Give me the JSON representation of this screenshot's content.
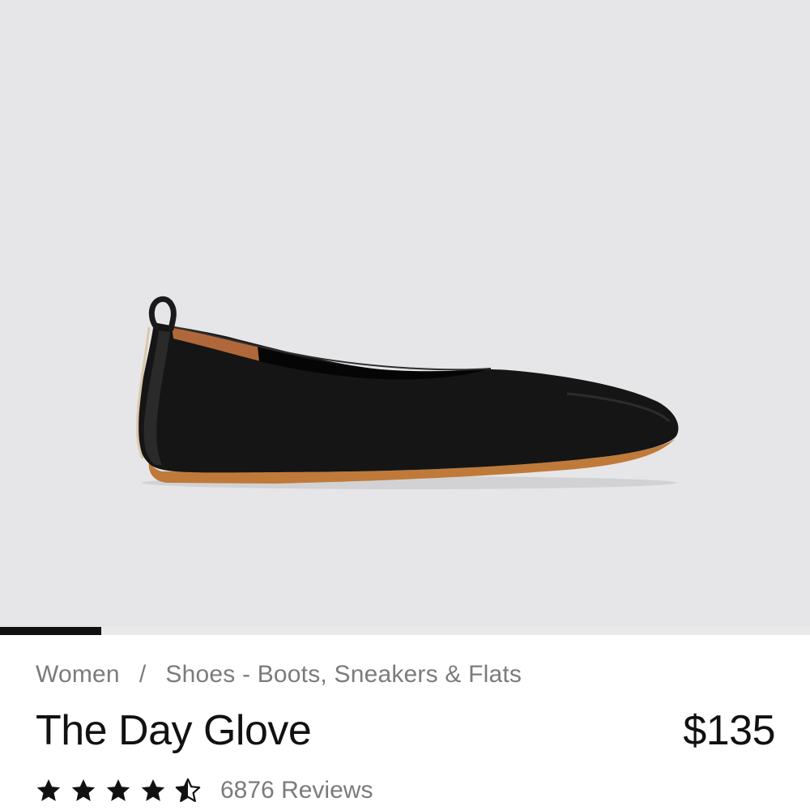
{
  "gallery": {
    "image_alt": "Black leather ballet flat with tan sole",
    "background": "#e6e6e8",
    "slide_progress": 0.125
  },
  "breadcrumb": {
    "items": [
      "Women",
      "Shoes - Boots, Sneakers & Flats"
    ],
    "separator": "/"
  },
  "product": {
    "title": "The Day Glove",
    "price": "$135",
    "rating": 4.5,
    "rating_max": 5,
    "reviews": "6876 Reviews"
  },
  "colors": {
    "text": "#111111",
    "muted": "#7b7b7b",
    "shoe_leather": "#141414",
    "sole": "#bf7a3a"
  },
  "icons": [
    "star-icon",
    "star-half-icon"
  ]
}
